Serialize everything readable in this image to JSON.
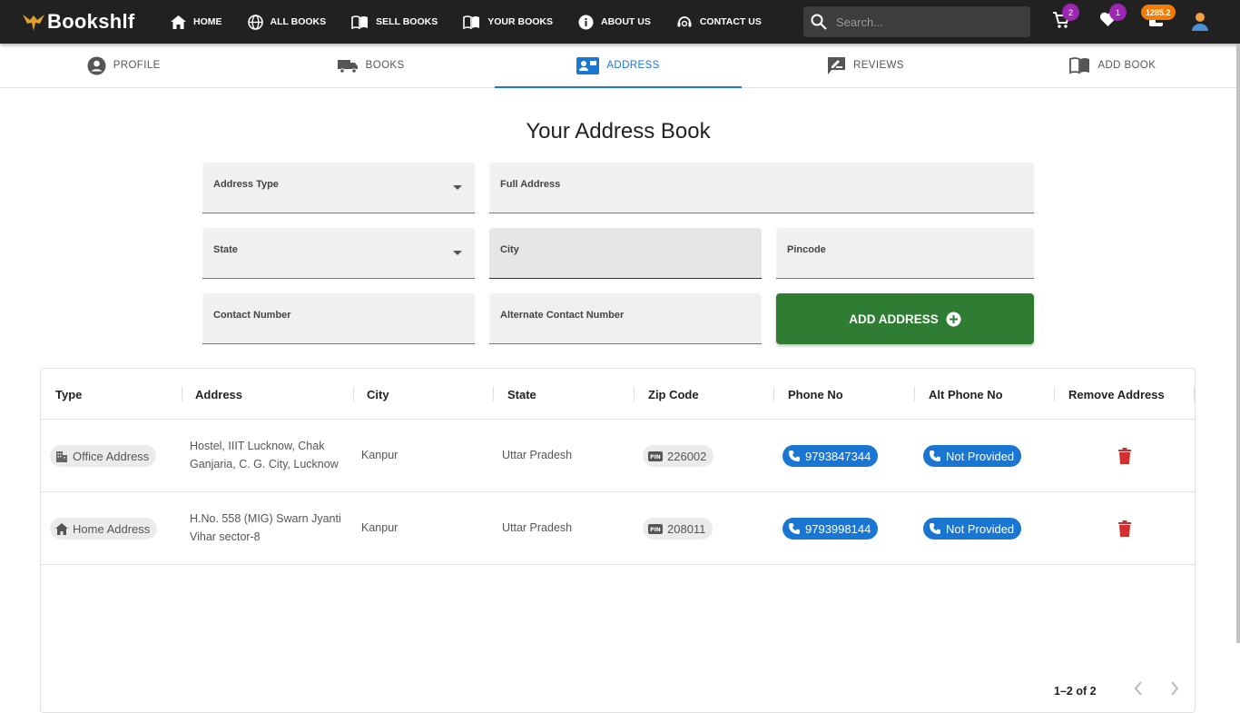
{
  "app": {
    "brand": "Bookshlf"
  },
  "nav": {
    "items": [
      {
        "label": "HOME"
      },
      {
        "label": "ALL BOOKS"
      },
      {
        "label": "SELL BOOKS"
      },
      {
        "label": "YOUR BOOKS"
      },
      {
        "label": "ABOUT US"
      },
      {
        "label": "CONTACT US"
      }
    ],
    "search_placeholder": "Search...",
    "cart_count": "2",
    "wishlist_count": "1",
    "wallet_amount": "1285.2"
  },
  "tabs": [
    {
      "label": "PROFILE"
    },
    {
      "label": "BOOKS"
    },
    {
      "label": "ADDRESS",
      "active": true
    },
    {
      "label": "REVIEWS"
    },
    {
      "label": "ADD BOOK"
    }
  ],
  "page_title": "Your Address Book",
  "form": {
    "address_type": "Address Type",
    "full_address": "Full Address",
    "state": "State",
    "city": "City",
    "pincode": "Pincode",
    "contact": "Contact Number",
    "alt_contact": "Alternate Contact Number",
    "submit": "ADD ADDRESS"
  },
  "table": {
    "columns": [
      "Type",
      "Address",
      "City",
      "State",
      "Zip Code",
      "Phone No",
      "Alt Phone No",
      "Remove Address"
    ],
    "rows": [
      {
        "type": "Office Address",
        "address_line1": "Hostel, IIIT Lucknow, Chak",
        "address_line2": "Ganjaria, C. G. City, Lucknow",
        "city": "Kanpur",
        "state": "Uttar Pradesh",
        "zip": "226002",
        "phone": "9793847344",
        "alt_phone": "Not Provided"
      },
      {
        "type": "Home Address",
        "address_line1": "H.No. 558 (MIG) Swarn Jyanti",
        "address_line2": "Vihar sector-8",
        "city": "Kanpur",
        "state": "Uttar Pradesh",
        "zip": "208011",
        "phone": "9793998144",
        "alt_phone": "Not Provided"
      }
    ],
    "pagination": "1–2 of 2"
  },
  "colors": {
    "nav_bg": "#212121",
    "accent": "#1976d2",
    "add_button": "#2e7d32",
    "danger": "#d32f2f",
    "badge_purple": "#9c27b0",
    "badge_orange": "#f57c00"
  }
}
